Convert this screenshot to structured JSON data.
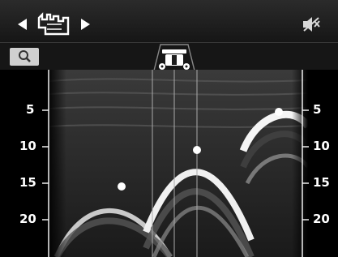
{
  "toolbar": {
    "nav_prev_icon": "triangle-left-icon",
    "mode_icon": "castle-soil-scan-icon",
    "nav_next_icon": "triangle-right-icon",
    "mute_icon": "speaker-muted-icon",
    "search_icon": "magnifier-icon",
    "device_icon": "scanner-cart-icon"
  },
  "scan": {
    "depth_left": [
      "5",
      "10",
      "15",
      "20"
    ],
    "depth_right": [
      "5",
      "10",
      "15",
      "20"
    ],
    "targets": [
      {
        "name": "target-1"
      },
      {
        "name": "target-2"
      },
      {
        "name": "target-3"
      }
    ],
    "colors": {
      "background": "#000000",
      "marker": "#ffffff"
    }
  }
}
